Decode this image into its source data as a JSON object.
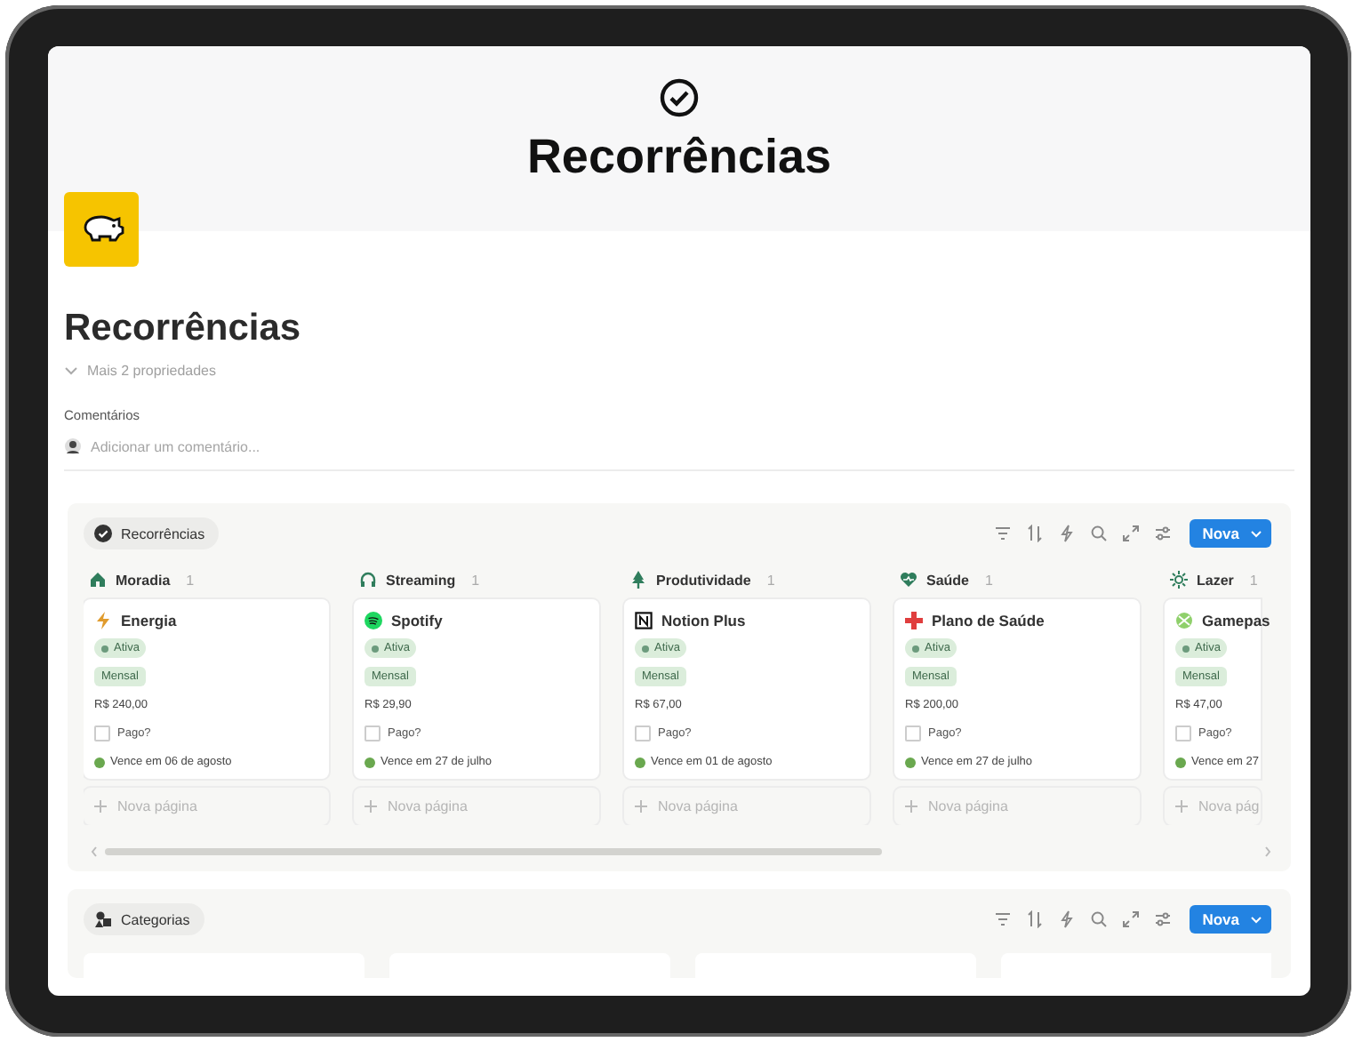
{
  "header": {
    "title": "Recorrências"
  },
  "page": {
    "title": "Recorrências",
    "more_properties": "Mais 2 propriedades",
    "comments_label": "Comentários",
    "comment_placeholder": "Adicionar um comentário..."
  },
  "databases": [
    {
      "tab": "Recorrências",
      "new_button": "Nova",
      "groups": [
        {
          "name": "Moradia",
          "count": "1",
          "cards": [
            {
              "title": "Energia",
              "status": "Ativa",
              "frequency": "Mensal",
              "price": "R$ 240,00",
              "paid_label": "Pago?",
              "paid": false,
              "due": "Vence em 06 de agosto"
            }
          ],
          "new_page": "Nova página"
        },
        {
          "name": "Streaming",
          "count": "1",
          "cards": [
            {
              "title": "Spotify",
              "status": "Ativa",
              "frequency": "Mensal",
              "price": "R$ 29,90",
              "paid_label": "Pago?",
              "paid": false,
              "due": "Vence em 27 de julho"
            }
          ],
          "new_page": "Nova página"
        },
        {
          "name": "Produtividade",
          "count": "1",
          "cards": [
            {
              "title": "Notion Plus",
              "status": "Ativa",
              "frequency": "Mensal",
              "price": "R$ 67,00",
              "paid_label": "Pago?",
              "paid": false,
              "due": "Vence em 01 de agosto"
            }
          ],
          "new_page": "Nova página"
        },
        {
          "name": "Saúde",
          "count": "1",
          "cards": [
            {
              "title": "Plano de Saúde",
              "status": "Ativa",
              "frequency": "Mensal",
              "price": "R$ 200,00",
              "paid_label": "Pago?",
              "paid": false,
              "due": "Vence em 27 de julho"
            }
          ],
          "new_page": "Nova página"
        },
        {
          "name": "Lazer",
          "count": "1",
          "cards": [
            {
              "title": "Gamepas",
              "status": "Ativa",
              "frequency": "Mensal",
              "price": "R$ 47,00",
              "paid_label": "Pago?",
              "paid": false,
              "due": "Vence em 27"
            }
          ],
          "new_page": "Nova pág"
        }
      ]
    },
    {
      "tab": "Categorias",
      "new_button": "Nova"
    }
  ]
}
